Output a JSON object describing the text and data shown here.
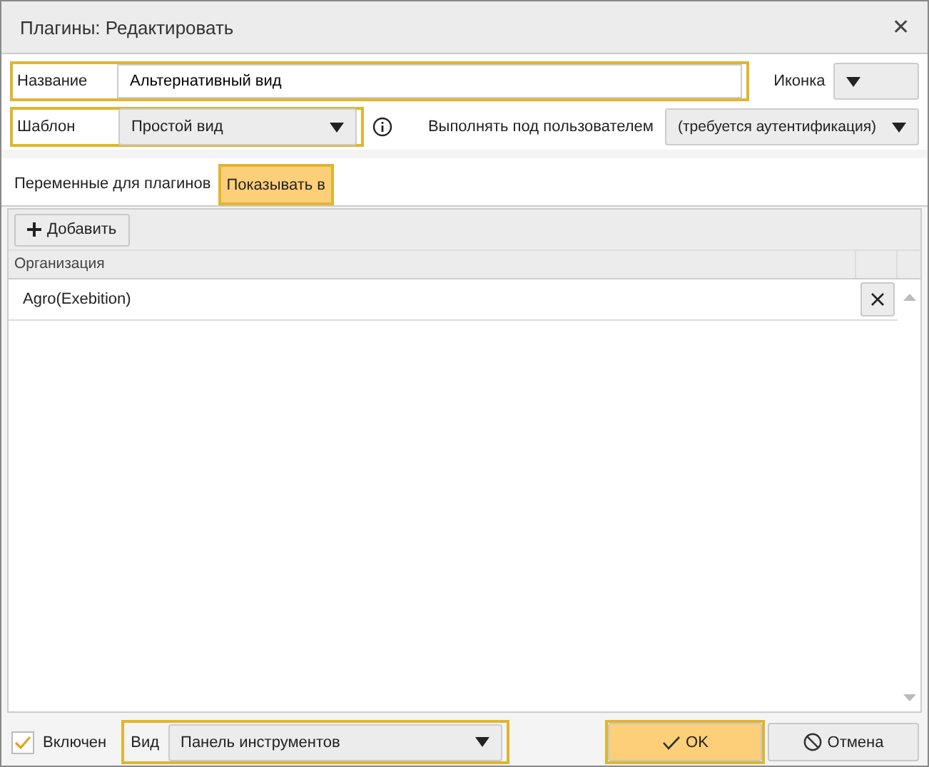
{
  "window": {
    "title": "Плагины: Редактировать",
    "close": "✕"
  },
  "name_field": {
    "label": "Название",
    "value": "Альтернативный вид",
    "highlighted": true
  },
  "icon_field": {
    "label": "Иконка"
  },
  "template_field": {
    "label": "Шаблон",
    "value": "Простой вид",
    "highlighted": true
  },
  "run_as_field": {
    "label": "Выполнять под пользователем",
    "value": "(требуется аутентификация)"
  },
  "tabs": [
    {
      "label": "Переменные для плагинов",
      "selected": false
    },
    {
      "label": "Показывать в",
      "selected": true
    }
  ],
  "toolbar": {
    "add_button": "Добавить"
  },
  "table": {
    "columns": [
      "Организация"
    ],
    "rows": [
      {
        "cells": [
          "Agro(Exebition)"
        ]
      }
    ]
  },
  "footer": {
    "enabled": {
      "label": "Включен",
      "checked": true
    },
    "view_field": {
      "label": "Вид",
      "value": "Панель инструментов",
      "highlighted": true
    },
    "buttons": [
      {
        "kind": "ok",
        "label": "OK",
        "highlighted": true
      },
      {
        "kind": "cancel",
        "label": "Отмена",
        "highlighted": false
      }
    ]
  }
}
